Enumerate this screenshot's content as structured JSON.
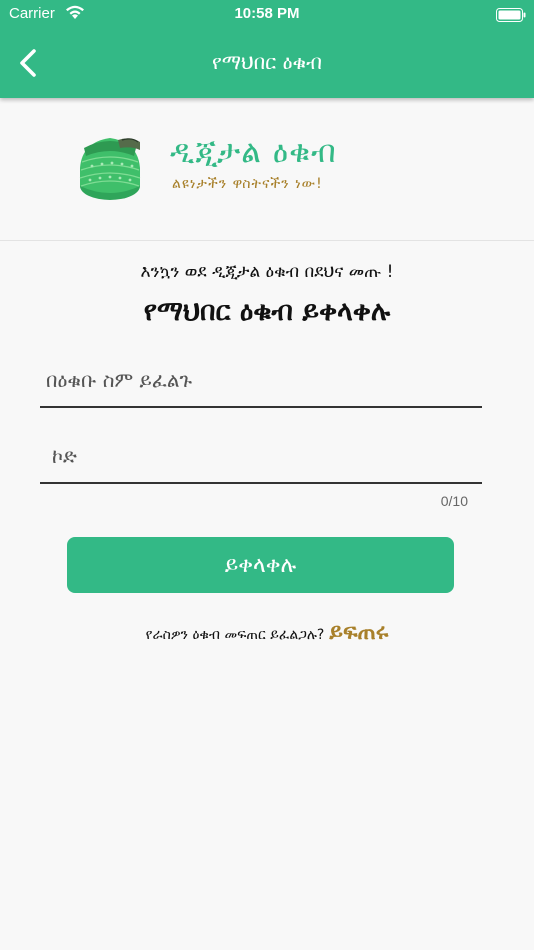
{
  "status_bar": {
    "carrier": "Carrier",
    "time": "10:58 PM"
  },
  "nav": {
    "title": "የማህበር ዕቁብ",
    "back_icon": "chevron-left-icon"
  },
  "brand": {
    "title": "ዲጂታል ዕቁብ",
    "tagline": "ልዩነታችን ዋስትናችን ነው!",
    "logo_icon": "basket-icon"
  },
  "form": {
    "welcome": "እንኳን ወደ ዲጂታል ዕቁብ በደህና መጡ !",
    "heading": "የማህበር ዕቁብ ይቀላቀሉ",
    "name_placeholder": "በዕቁቡ ስም ይፈልጉ",
    "code_placeholder": "ኮድ",
    "code_counter": "0/10",
    "join_label": "ይቀላቀሉ",
    "create_question": "የራስዎን ዕቁብ መፍጠር ይፈልጋሉ?",
    "create_link": "ይፍጠሩ"
  },
  "colors": {
    "primary": "#33b986",
    "accent": "#a8802a"
  }
}
